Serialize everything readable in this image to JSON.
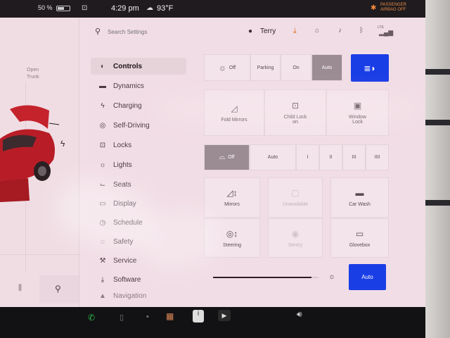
{
  "status": {
    "battery": "50 %",
    "time": "4:29 pm",
    "weather_icon": "cloud-icon",
    "temperature": "93°F",
    "passenger_airbag_line1": "PASSENGER",
    "passenger_airbag_line2": "AIRBAG OFF"
  },
  "left_panel": {
    "trunk_label_line1": "Open",
    "trunk_label_line2": "Trunk"
  },
  "header": {
    "search_placeholder": "Search Settings",
    "user_name": "Terry",
    "lte_label": "LTE"
  },
  "sidebar": {
    "items": [
      {
        "label": "Controls",
        "icon": "toggle-icon",
        "glyph": "◐"
      },
      {
        "label": "Dynamics",
        "icon": "car-icon",
        "glyph": "▬"
      },
      {
        "label": "Charging",
        "icon": "bolt-icon",
        "glyph": "ϟ"
      },
      {
        "label": "Self-Driving",
        "icon": "steering-wheel-icon",
        "glyph": "◎"
      },
      {
        "label": "Locks",
        "icon": "lock-icon",
        "glyph": "⊡"
      },
      {
        "label": "Lights",
        "icon": "sun-icon",
        "glyph": "☼"
      },
      {
        "label": "Seats",
        "icon": "seat-icon",
        "glyph": "⌙"
      },
      {
        "label": "Display",
        "icon": "display-icon",
        "glyph": "▭"
      },
      {
        "label": "Schedule",
        "icon": "clock-icon",
        "glyph": "◷"
      },
      {
        "label": "Safety",
        "icon": "shield-icon",
        "glyph": "◌"
      },
      {
        "label": "Service",
        "icon": "wrench-icon",
        "glyph": "⚒"
      },
      {
        "label": "Software",
        "icon": "download-icon",
        "glyph": "⤓"
      },
      {
        "label": "Navigation",
        "icon": "navigation-icon",
        "glyph": "▲"
      }
    ]
  },
  "controls": {
    "headlights": {
      "off": "Off",
      "parking": "Parking",
      "on": "On",
      "auto": "Auto"
    },
    "tiles_row1": [
      "Fold Mirrors",
      "Child Lock on",
      "Window Lock"
    ],
    "wipers": {
      "off": "Off",
      "auto": "Auto",
      "speeds": [
        "I",
        "II",
        "III",
        "IIII"
      ]
    },
    "tiles_row2": [
      "Mirrors",
      "Unavailable",
      "Car Wash"
    ],
    "tiles_row3": [
      "Steering",
      "Sentry",
      "Glovebox"
    ],
    "brightness_auto": "Auto",
    "brightness_level": 0.93
  },
  "colors": {
    "accent_blue": "#1a3ee6",
    "selected_gray": "#9b8b93",
    "background": "#f1dde5"
  }
}
